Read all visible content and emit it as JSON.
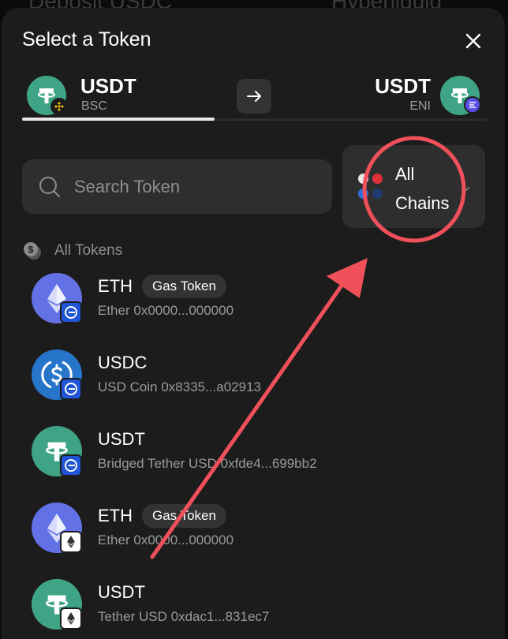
{
  "backdrop": {
    "left_text": "Deposit  USDC",
    "right_text": "Hyperliquid"
  },
  "modal": {
    "title": "Select a Token",
    "pair": {
      "from": {
        "symbol": "USDT",
        "chain": "BSC"
      },
      "to": {
        "symbol": "USDT",
        "chain": "ENI"
      }
    },
    "search": {
      "placeholder": "Search Token",
      "value": ""
    },
    "chains_button": {
      "label_line1": "All",
      "label_line2": "Chains"
    },
    "section_label": "All Tokens",
    "tokens": [
      {
        "symbol": "ETH",
        "tag": "Gas Token",
        "name": "Ether",
        "address": "0x0000...000000",
        "icon": "eth-icon",
        "chain_icon": "eni-chain-icon"
      },
      {
        "symbol": "USDC",
        "tag": "",
        "name": "USD Coin",
        "address": "0x8335...a02913",
        "icon": "usdc-icon",
        "chain_icon": "eni-chain-icon"
      },
      {
        "symbol": "USDT",
        "tag": "",
        "name": "Bridged Tether USD",
        "address": "0xfde4...699bb2",
        "icon": "usdt-icon",
        "chain_icon": "eni-chain-icon"
      },
      {
        "symbol": "ETH",
        "tag": "Gas Token",
        "name": "Ether",
        "address": "0x0000...000000",
        "icon": "eth-icon",
        "chain_icon": "ethereum-chain-icon"
      },
      {
        "symbol": "USDT",
        "tag": "",
        "name": "Tether USD",
        "address": "0xdac1...831ec7",
        "icon": "usdt-icon",
        "chain_icon": "ethereum-chain-icon"
      }
    ]
  },
  "colors": {
    "modal_bg": "#1c1c1c",
    "surface": "#2e2e2e",
    "tether_green": "#3fa486",
    "eth_purple": "#6272e6",
    "usdc_blue": "#2775ca",
    "annotation_red": "#f0505a"
  }
}
